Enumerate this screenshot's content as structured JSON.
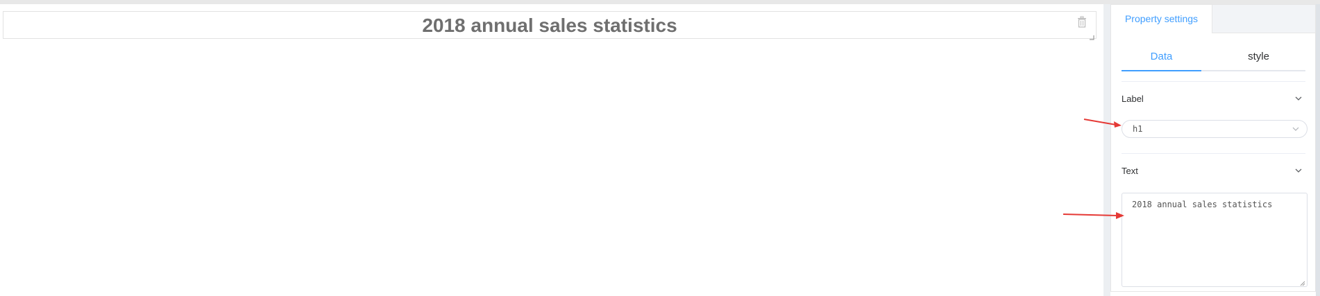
{
  "canvas": {
    "widget": {
      "title": "2018 annual sales statistics",
      "delete_icon": "trash-icon",
      "resize_icon": "resize-handle-icon"
    }
  },
  "panel": {
    "tabs": [
      {
        "label": "Property settings",
        "active": true
      }
    ],
    "sub_tabs": [
      {
        "label": "Data",
        "active": true
      },
      {
        "label": "style",
        "active": false
      }
    ],
    "label_section": {
      "heading": "Label",
      "select_value": "h1"
    },
    "text_section": {
      "heading": "Text",
      "textarea_value": "2018 annual sales statistics"
    }
  },
  "colors": {
    "accent": "#409eff",
    "title_text": "#6f6f6f",
    "annotation_arrow": "#e53935"
  }
}
